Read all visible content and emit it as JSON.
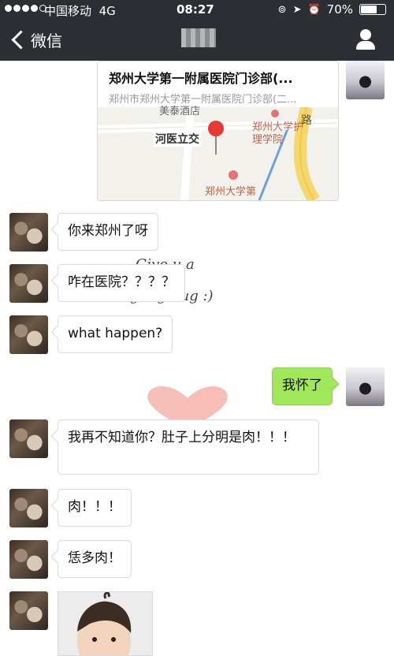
{
  "status_bar": {
    "carrier": "中国移动",
    "network": "4G",
    "time": "08:27",
    "battery": "70%",
    "battery_level": 0.7
  },
  "nav": {
    "back_label": "微信"
  },
  "location_card": {
    "title": "郑州大学第一附属医院门诊部(...",
    "subtitle": "郑州市郑州大学第一附属医院门诊部(二...",
    "map_labels": {
      "hotel": "美泰酒店",
      "road_label": "河医立交",
      "nursing_school": "郑州大学护理学院",
      "road_char": "路",
      "hospital": "郑州大学第"
    }
  },
  "messages": [
    {
      "from": "friend",
      "text": "你来郑州了呀"
    },
    {
      "from": "friend",
      "text": "咋在医院？？？？"
    },
    {
      "from": "friend",
      "text": "what  happen?"
    },
    {
      "from": "me",
      "text": "我怀了"
    },
    {
      "from": "friend",
      "text": "我再不知道你？肚子上分明是肉！！！"
    },
    {
      "from": "friend",
      "text": "肉！！！"
    },
    {
      "from": "friend",
      "text": "恁多肉！"
    }
  ],
  "background_doodle": {
    "line1": "Give u a",
    "line2": "big big hug :)"
  },
  "colors": {
    "nav_bg": "#2b2f33",
    "my_bubble": "#a0e75a",
    "heart": "#f08a7e"
  }
}
